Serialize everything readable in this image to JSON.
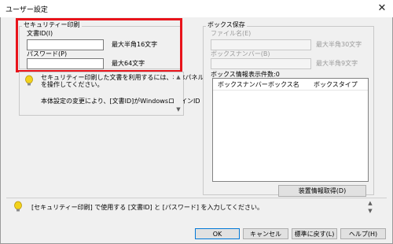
{
  "window": {
    "title": "ユーザー設定",
    "close_glyph": "✕"
  },
  "security_print": {
    "group_label": "セキュリティー印刷",
    "doc_id_label": "文書ID(I)",
    "doc_id_value": "",
    "doc_id_hint": "最大半角16文字",
    "password_label": "パスワード(P)",
    "password_value": "",
    "password_hint": "最大64文字"
  },
  "info_panel": {
    "line1": "セキュリティー印刷した文書を利用するには、本体パネル",
    "line2": "を操作してください。",
    "line3": "本体設定の変更により、[文書ID]がWindowsログインID"
  },
  "box_save": {
    "group_label": "ボックス保存",
    "file_name_label": "ファイル名(E)",
    "file_name_hint": "最大半角30文字",
    "box_number_label": "ボックスナンバー(B)",
    "box_number_hint": "最大半角9文字",
    "box_info_label": "ボックス情報",
    "count_label": "表示件数:0",
    "columns": [
      "ボックスナンバー",
      "ボックス名",
      "ボックスタイプ"
    ],
    "fetch_button": "装置情報取得(D)"
  },
  "hint_bar": {
    "text": "[セキュリティー印刷] で使用する [文書ID] と [パスワード] を入力してください。"
  },
  "buttons": {
    "ok": "OK",
    "cancel": "キャンセル",
    "default": "標準に戻す(L)",
    "help": "ヘルプ(H)"
  },
  "colors": {
    "highlight": "#e8141b",
    "default_border": "#0078d7",
    "bulb": "#f2d21b"
  }
}
